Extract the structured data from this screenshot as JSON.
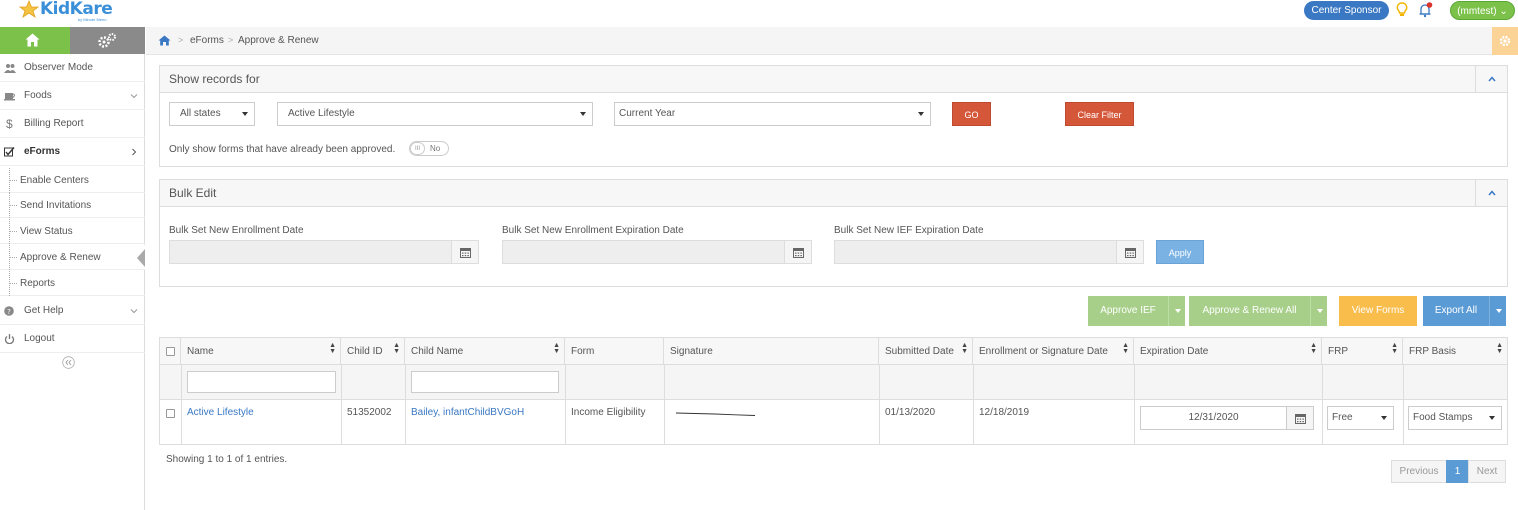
{
  "brand": {
    "name": "KidKare",
    "sub": "by Minute Menu"
  },
  "topbar": {
    "role_label": "Center Sponsor",
    "user_label": "(mmtest)",
    "bell_badge": "1"
  },
  "sidebar": {
    "items": [
      {
        "label": "Observer Mode",
        "icon": "users-icon"
      },
      {
        "label": "Foods",
        "icon": "cup-icon"
      },
      {
        "label": "Billing Report",
        "icon": "dollar-icon"
      },
      {
        "label": "eForms",
        "icon": "checkbox-icon"
      },
      {
        "label": "Get Help",
        "icon": "question-icon"
      },
      {
        "label": "Logout",
        "icon": "power-icon"
      }
    ],
    "subitems": [
      {
        "label": "Enable Centers"
      },
      {
        "label": "Send Invitations"
      },
      {
        "label": "View Status"
      },
      {
        "label": "Approve & Renew"
      },
      {
        "label": "Reports"
      }
    ]
  },
  "breadcrumb": {
    "sep": ">",
    "level1": "eForms",
    "level2": "Approve & Renew"
  },
  "filters": {
    "title": "Show records for",
    "state_select": "All states",
    "center_select": "Active Lifestyle",
    "period_select": "Current Year",
    "go_label": "GO",
    "clear_label": "Clear Filter",
    "approved_text": "Only show forms that have already been approved.",
    "toggle_knob": "III",
    "toggle_label": "No"
  },
  "bulk": {
    "title": "Bulk Edit",
    "enroll_label": "Bulk Set New Enrollment Date",
    "enroll_exp_label": "Bulk Set New Enrollment Expiration Date",
    "ief_exp_label": "Bulk Set New IEF Expiration Date",
    "apply_label": "Apply"
  },
  "actions": {
    "approve_ief": "Approve IEF",
    "approve_renew_all": "Approve & Renew All",
    "view_forms": "View Forms",
    "export_all": "Export All"
  },
  "table": {
    "columns": [
      "Name",
      "Child ID",
      "Child Name",
      "Form",
      "Signature",
      "Submitted Date",
      "Enrollment or Signature Date",
      "Expiration Date",
      "FRP",
      "FRP Basis"
    ],
    "rows": [
      {
        "name": "Active Lifestyle",
        "child_id": "51352002",
        "child_name": "Bailey, infantChildBVGoH",
        "form": "Income Eligibility",
        "submitted": "01/13/2020",
        "enrollment": "12/18/2019",
        "expiration": "12/31/2020",
        "frp": "Free",
        "frp_basis": "Food Stamps"
      }
    ]
  },
  "footer": {
    "showing": "Showing 1 to 1 of 1 entries.",
    "prev": "Previous",
    "page": "1",
    "next": "Next"
  },
  "colors": {
    "green": "#7cc24a",
    "blue": "#3a78c3",
    "orange_red": "#d4573a",
    "yellow": "#f9bd4c",
    "light_blue": "#5b9bd5",
    "light_green": "#a7cf8a"
  }
}
